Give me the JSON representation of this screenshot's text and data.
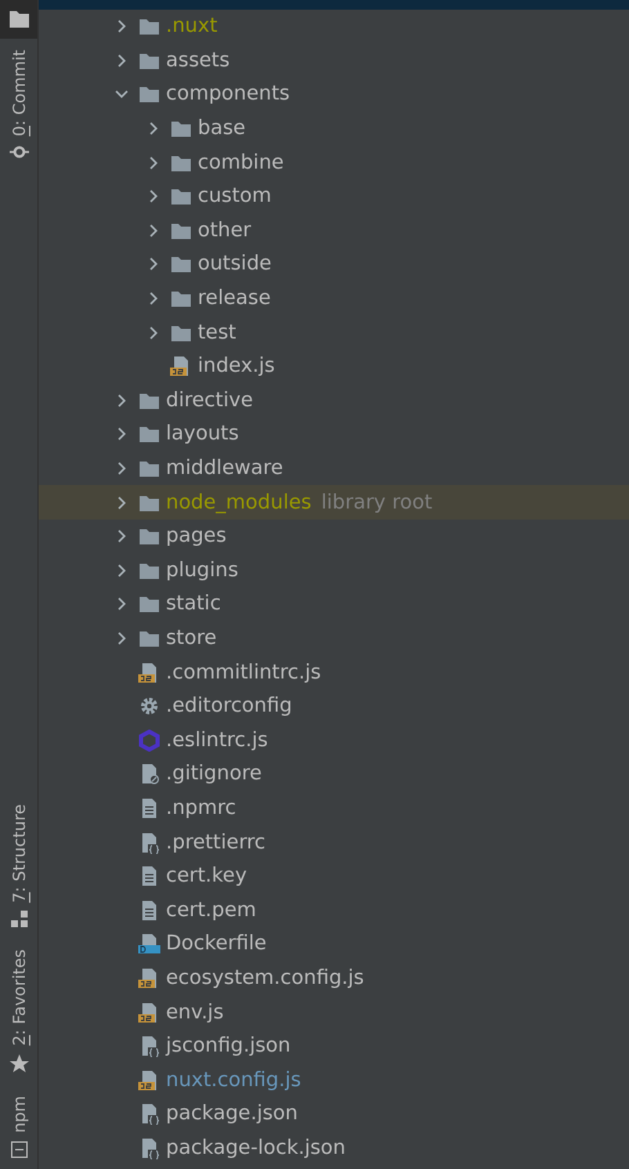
{
  "tool_strip": {
    "top": [
      {
        "kind": "project",
        "selected": true
      },
      {
        "kind": "commit",
        "key": "0",
        "label": ": Commit",
        "selected": false
      }
    ],
    "bottom": [
      {
        "kind": "structure",
        "key": "7",
        "label": ": Structure",
        "selected": false
      },
      {
        "kind": "favorites",
        "key": "2",
        "label": ": Favorites",
        "selected": false
      },
      {
        "kind": "npm",
        "label": "npm",
        "selected": false
      }
    ]
  },
  "tree": [
    {
      "kind": "folder",
      "name": ".nuxt",
      "color": "#999900",
      "expanded": false
    },
    {
      "kind": "folder",
      "name": "assets",
      "expanded": false
    },
    {
      "kind": "folder",
      "name": "components",
      "expanded": true,
      "children": [
        {
          "kind": "folder",
          "name": "base",
          "expanded": false
        },
        {
          "kind": "folder",
          "name": "combine",
          "expanded": false
        },
        {
          "kind": "folder",
          "name": "custom",
          "expanded": false
        },
        {
          "kind": "folder",
          "name": "other",
          "expanded": false
        },
        {
          "kind": "folder",
          "name": "outside",
          "expanded": false
        },
        {
          "kind": "folder",
          "name": "release",
          "expanded": false
        },
        {
          "kind": "folder",
          "name": "test",
          "expanded": false
        },
        {
          "kind": "js",
          "name": "index.js"
        }
      ]
    },
    {
      "kind": "folder",
      "name": "directive",
      "expanded": false
    },
    {
      "kind": "folder",
      "name": "layouts",
      "expanded": false
    },
    {
      "kind": "folder",
      "name": "middleware",
      "expanded": false
    },
    {
      "kind": "folder",
      "name": "node_modules",
      "color": "#999900",
      "expanded": false,
      "highlighted": true,
      "note": "library root"
    },
    {
      "kind": "folder",
      "name": "pages",
      "expanded": false
    },
    {
      "kind": "folder",
      "name": "plugins",
      "expanded": false
    },
    {
      "kind": "folder",
      "name": "static",
      "expanded": false
    },
    {
      "kind": "folder",
      "name": "store",
      "expanded": false
    },
    {
      "kind": "js",
      "name": ".commitlintrc.js"
    },
    {
      "kind": "gear",
      "name": ".editorconfig"
    },
    {
      "kind": "eslint",
      "name": ".eslintrc.js"
    },
    {
      "kind": "gitignore",
      "name": ".gitignore"
    },
    {
      "kind": "text",
      "name": ".npmrc"
    },
    {
      "kind": "config",
      "name": ".prettierrc"
    },
    {
      "kind": "text",
      "name": "cert.key"
    },
    {
      "kind": "text",
      "name": "cert.pem"
    },
    {
      "kind": "docker",
      "name": "Dockerfile"
    },
    {
      "kind": "js",
      "name": "ecosystem.config.js"
    },
    {
      "kind": "js",
      "name": "env.js"
    },
    {
      "kind": "config",
      "name": "jsconfig.json"
    },
    {
      "kind": "js",
      "name": "nuxt.config.js",
      "color": "#6897bb"
    },
    {
      "kind": "config",
      "name": "package.json"
    },
    {
      "kind": "config",
      "name": "package-lock.json"
    }
  ]
}
